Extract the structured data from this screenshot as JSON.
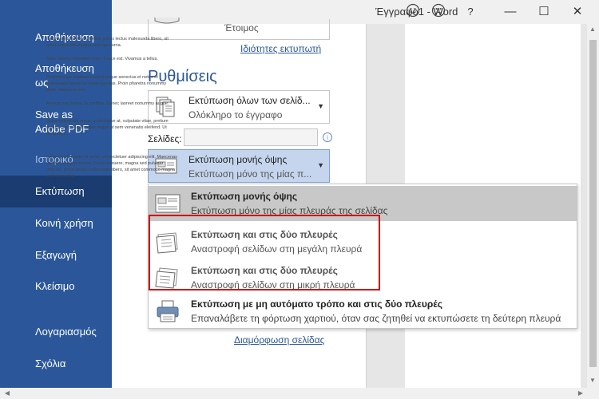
{
  "window": {
    "title": "Έγγραφο1 - Word",
    "help": "?",
    "minimize": "—",
    "maximize": "☐",
    "close": "✕"
  },
  "nav": {
    "items": [
      {
        "label": "Αποθήκευση"
      },
      {
        "label": "Αποθήκευση ως"
      },
      {
        "label": "Save as Adobe PDF"
      },
      {
        "label": "Ιστορικό"
      },
      {
        "label": "Εκτύπωση"
      },
      {
        "label": "Κοινή χρήση"
      },
      {
        "label": "Εξαγωγή"
      },
      {
        "label": "Κλείσιμο"
      },
      {
        "label": "Λογαριασμός"
      },
      {
        "label": "Σχόλια"
      }
    ]
  },
  "printer": {
    "status": "Έτοιμος",
    "properties_link": "Ιδιότητες εκτυπωτή"
  },
  "settings": {
    "title": "Ρυθμίσεις",
    "range": {
      "main": "Εκτύπωση όλων των σελίδ...",
      "sub": "Ολόκληρο το έγγραφο"
    },
    "pages_label": "Σελίδες:",
    "sides": {
      "main": "Εκτύπωση μονής όψης",
      "sub": "Εκτύπωση μόνο της μίας π..."
    },
    "page_setup_link": "Διαμόρφωση σελίδας"
  },
  "popup": {
    "items": [
      {
        "main": "Εκτύπωση μονής όψης",
        "sub": "Εκτύπωση μόνο της μίας πλευράς της σελίδας"
      },
      {
        "main": "Εκτύπωση και στις δύο πλευρές",
        "sub": "Αναστροφή σελίδων στη μεγάλη πλευρά"
      },
      {
        "main": "Εκτύπωση και στις δύο πλευρές",
        "sub": "Αναστροφή σελίδων στη μικρή πλευρά"
      },
      {
        "main": "Εκτύπωση με μη αυτόματο τρόπο και στις δύο πλευρές",
        "sub": "Επαναλάβετε τη φόρτωση χαρτιού, όταν σας ζητηθεί να εκτυπώσετε τη δεύτερη πλευρά"
      }
    ]
  },
  "preview": {
    "paragraphs": [
      "magna sed pulvinar ultricies, purus lectus malesuada libero, sit amet commodo magna eros quis urna.",
      "Nunc viverra imperdiet enim. Fusce est. Vivamus a tellus.",
      "Pellentesque habitant morbi tristique senectus et netus et malesuada fames ac turpis egestas. Proin pharetra nonummy pede. Mauris et orci.",
      "Aenean nec lorem. In porttitor. Donec laoreet nonummy augue.",
      "Suspendisse dui purus, scelerisque at, vulputate vitae, pretium mattis, nunc. Mauris eget neque at sem venenatis eleifend. Ut nonummy.",
      "Lorem ipsum dolor sit amet, consectetuer adipiscing elit. Maecenas porttitor congue massa. Fusce posuere, magna sed pulvinar ultricies, purus lectus malesuada libero, sit amet commodo magna eros quis urna."
    ]
  },
  "colors": {
    "accent": "#2b579a",
    "nav_active": "#1a3c70",
    "highlight": "#d10000"
  }
}
